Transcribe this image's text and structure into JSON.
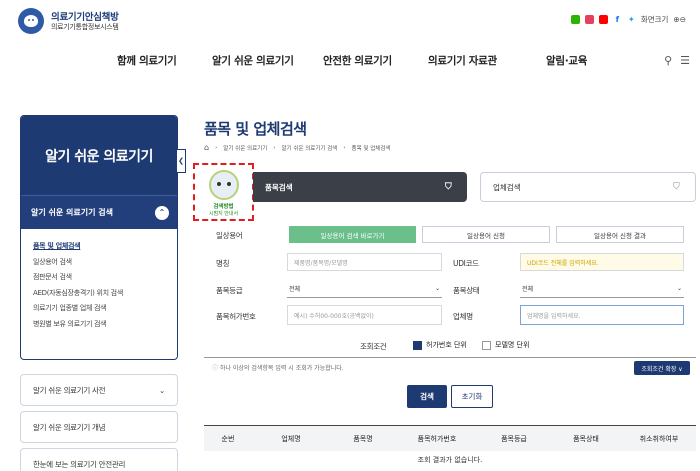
{
  "header": {
    "logo_title": "의료기기안심책방",
    "logo_subtitle": "의료기기통합정보시스템",
    "font_size_label": "화면크기",
    "font_size_controls": "⊕⊖"
  },
  "nav": {
    "items": [
      "함께 의료기기",
      "알기 쉬운 의료기기",
      "안전한 의료기기",
      "의료기기 자료관",
      "알림·교육"
    ]
  },
  "sidebar": {
    "title": "알기 쉬운 의료기기",
    "sub_title": "알기 쉬운 의료기기 검색",
    "items": [
      "품목 및 업체검색",
      "일상용어 검색",
      "점판문서 검색",
      "AED(자동심장충격기) 위치 검색",
      "의료기기 업종별 업체 검색",
      "병원별 보유 의료기기 검색"
    ],
    "cards": [
      "알기 쉬운 의료기기 사전",
      "알기 쉬운 의료기기 개념",
      "한눈에 보는 의료기기 안전관리"
    ]
  },
  "main": {
    "title": "품목 및 업체검색",
    "breadcrumb": [
      "알기 쉬운 의료기기",
      "알기 쉬운 의료기기 검색",
      "품목 및 업체검색"
    ],
    "mascot_line1": "검색방법",
    "mascot_line2": "시범지 안내서",
    "tab_product": "품목검색",
    "tab_company": "업체검색",
    "daily_term_label": "일상용어",
    "daily_btn1": "일상용어 검색 바로가기",
    "daily_btn2": "일상용어 신청",
    "daily_btn3": "일상용어 신청 결과",
    "name_label": "명칭",
    "name_placeholder": "제품명/품목명/모델명",
    "udi_label": "UDI코드",
    "udi_placeholder": "UDI코드 전체를 입력하세요.",
    "grade_label": "품목등급",
    "grade_value": "전체",
    "status_label": "품목상태",
    "status_value": "전체",
    "permit_label": "품목허가번호",
    "permit_placeholder": "예시) 수허00-000호(공백없이)",
    "company_label": "업체명",
    "company_placeholder": "업체명을 입력하세요.",
    "cond_label": "조회조건",
    "cond_opt1": "허가번호 단위",
    "cond_opt2": "모델명 단위",
    "note": "하나 이상의 검색항목 입력 시 조회가 가능합니다.",
    "cond_expand": "조회조건 확장 ∨",
    "search_btn": "검색",
    "reset_btn": "초기화",
    "table_headers": [
      "순번",
      "업체명",
      "품목명",
      "품목허가번호",
      "품목등급",
      "품목상태",
      "취소취하여부"
    ],
    "empty_text": "조회 결과가 없습니다."
  }
}
